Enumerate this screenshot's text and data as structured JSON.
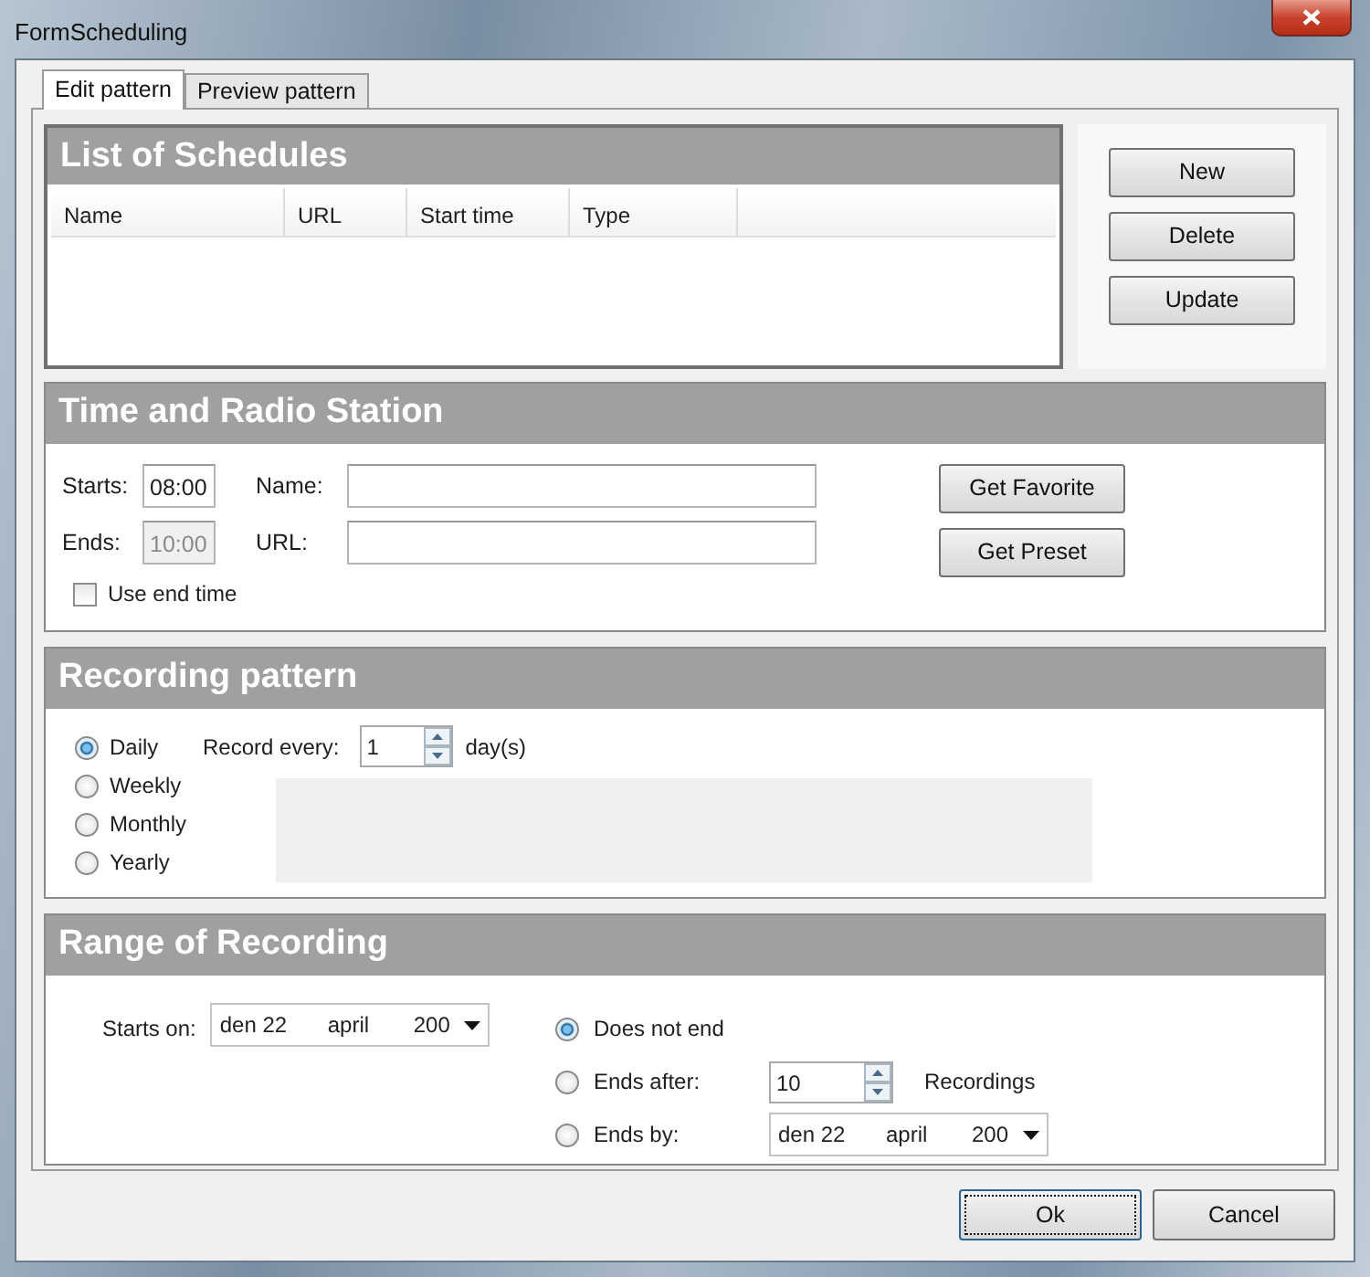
{
  "window": {
    "title": "FormScheduling"
  },
  "tabs": [
    {
      "label": "Edit pattern",
      "selected": true
    },
    {
      "label": "Preview pattern",
      "selected": false
    }
  ],
  "schedules": {
    "title": "List of Schedules",
    "columns": [
      "Name",
      "URL",
      "Start time",
      "Type"
    ]
  },
  "schedule_buttons": [
    "New",
    "Delete",
    "Update"
  ],
  "time_station": {
    "title": "Time and Radio Station",
    "starts_label": "Starts:",
    "starts_value": "08:00",
    "ends_label": "Ends:",
    "ends_value": "10:00",
    "ends_disabled": true,
    "name_label": "Name:",
    "url_label": "URL:",
    "use_end_time": {
      "label": "Use end time",
      "checked": false
    },
    "buttons": [
      "Get Favorite",
      "Get Preset"
    ]
  },
  "recording_pattern": {
    "title": "Recording pattern",
    "options": [
      {
        "label": "Daily",
        "selected": true
      },
      {
        "label": "Weekly",
        "selected": false
      },
      {
        "label": "Monthly",
        "selected": false
      },
      {
        "label": "Yearly",
        "selected": false
      }
    ],
    "record_every_label": "Record every:",
    "record_every_value": "1",
    "unit": "day(s)"
  },
  "range": {
    "title": "Range of Recording",
    "starts_on_label": "Starts on:",
    "starts_on": {
      "day": "den 22",
      "month": "april",
      "year": "200"
    },
    "end_options": [
      {
        "kind": "none",
        "label": "Does not end",
        "selected": true
      },
      {
        "kind": "after",
        "label": "Ends after:",
        "selected": false,
        "value": "10",
        "unit": "Recordings"
      },
      {
        "kind": "by",
        "label": "Ends by:",
        "selected": false,
        "date": {
          "day": "den 22",
          "month": "april",
          "year": "200"
        }
      }
    ]
  },
  "footer_buttons": [
    {
      "label": "Ok",
      "focused": true
    },
    {
      "label": "Cancel",
      "focused": false
    }
  ]
}
